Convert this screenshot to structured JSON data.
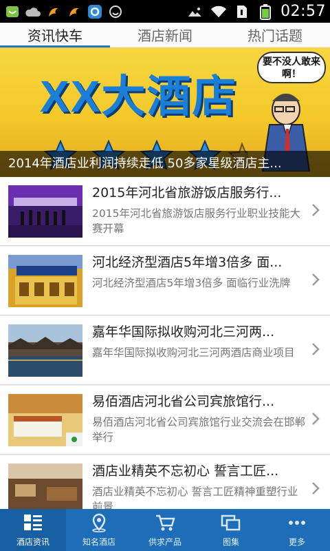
{
  "status_bar": {
    "time": "02:57",
    "icons": [
      "android-icon",
      "cloud-icon",
      "uc-browser-icon",
      "uc-browser-icon",
      "search-app-icon",
      "smile-icon",
      "picture-icon",
      "wifi-icon",
      "sim-icon",
      "battery-icon"
    ]
  },
  "tabs": [
    {
      "label": "资讯快车",
      "active": true
    },
    {
      "label": "酒店新闻",
      "active": false
    },
    {
      "label": "热门话题",
      "active": false
    }
  ],
  "banner": {
    "title": "XX大酒店",
    "bubble": "要不没人敢来啊！",
    "caption": "2014年酒店业利润持续走低 50多家星级酒店主..."
  },
  "news": [
    {
      "title": "2015年河北省旅游饭店服务行...",
      "desc": "2015年河北省旅游饭店服务行业职业技能大赛开幕",
      "thumb": "stage-photo"
    },
    {
      "title": "河北经济型酒店5年增3倍多 面...",
      "desc": "河北经济型酒店5年增3倍多 面临行业洗牌",
      "thumb": "hotel-facade-photo"
    },
    {
      "title": "嘉年华国际拟收购河北三河两...",
      "desc": "嘉年华国际拟收购河北三河两酒店商业项目",
      "thumb": "waterfront-photo"
    },
    {
      "title": "易佰酒店河北省公司宾旅馆行...",
      "desc": "易佰酒店河北省公司宾旅馆行业交流会在邯郸举行",
      "thumb": "hotel-room-photo"
    },
    {
      "title": "酒店业精英不忘初心 誓言工匠...",
      "desc": "酒店业精英不忘初心 誓言工匠精神重塑行业前景",
      "thumb": "lobby-photo"
    }
  ],
  "bottom_nav": [
    {
      "label": "酒店资讯",
      "icon": "grid-list-icon",
      "active": true
    },
    {
      "label": "知名酒店",
      "icon": "location-pin-icon",
      "active": false
    },
    {
      "label": "供求产品",
      "icon": "cart-icon",
      "active": false
    },
    {
      "label": "图集",
      "icon": "gallery-icon",
      "active": false
    },
    {
      "label": "更多",
      "icon": "more-dots-icon",
      "active": false
    }
  ],
  "colors": {
    "accent": "#1e78c8",
    "nav_bg": "#1d6db8",
    "banner_yellow": "#f4c829"
  }
}
